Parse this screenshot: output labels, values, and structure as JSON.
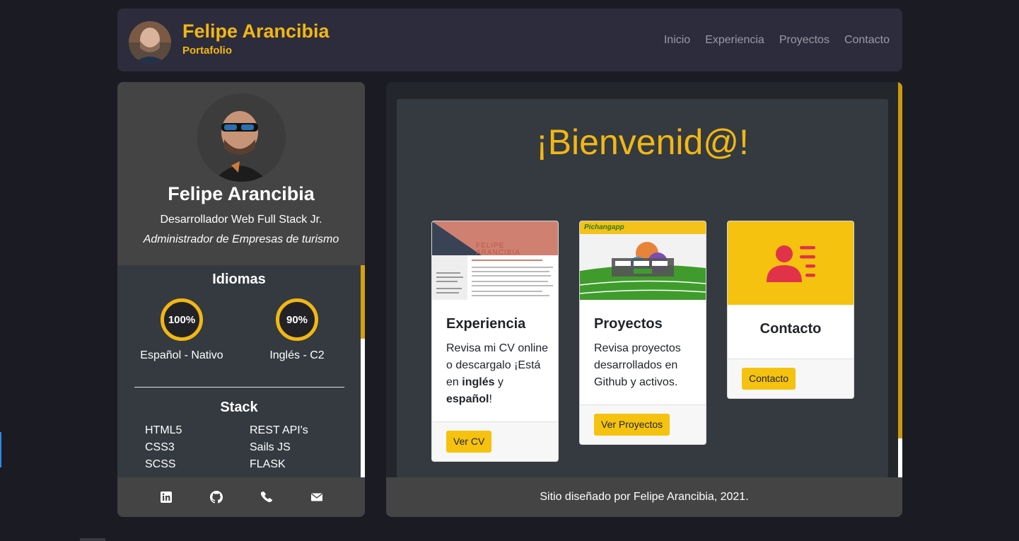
{
  "nav": {
    "brand_name": "Felipe Arancibia",
    "brand_sub": "Portafolio",
    "links": [
      "Inicio",
      "Experiencia",
      "Proyectos",
      "Contacto"
    ]
  },
  "sidebar": {
    "name": "Felipe Arancibia",
    "role": "Desarrollador Web Full Stack Jr.",
    "role2": "Administrador de Empresas de turismo",
    "languages_title": "Idiomas",
    "languages": [
      {
        "percent": "100%",
        "label": "Español - Nativo"
      },
      {
        "percent": "90%",
        "label": "Inglés - C2"
      }
    ],
    "stack_title": "Stack",
    "stack_left": [
      "HTML5",
      "CSS3",
      "SCSS"
    ],
    "stack_right": [
      "REST API's",
      "Sails JS",
      "FLASK"
    ],
    "social_icons": [
      "linkedin-icon",
      "github-icon",
      "phone-icon",
      "mail-icon"
    ]
  },
  "main": {
    "welcome": "¡Bienvenid@!",
    "cards": [
      {
        "title": "Experiencia",
        "text_parts": [
          "Revisa mi CV online o descargalo ¡Está en ",
          "inglés",
          " y ",
          "español",
          "!"
        ],
        "button": "Ver CV",
        "cv_name": "FELIPE ARANCIBIA"
      },
      {
        "title": "Proyectos",
        "text": "Revisa proyectos desarrollados en Github y activos.",
        "button": "Ver Proyectos",
        "logo": "Pichangapp"
      },
      {
        "title": "Contacto",
        "button": "Contacto"
      }
    ],
    "footer": "Sitio diseñado por Felipe Arancibia, 2021."
  },
  "colors": {
    "accent": "#f2b713",
    "button": "#f5c20f",
    "contact_icon": "#e0334a"
  }
}
